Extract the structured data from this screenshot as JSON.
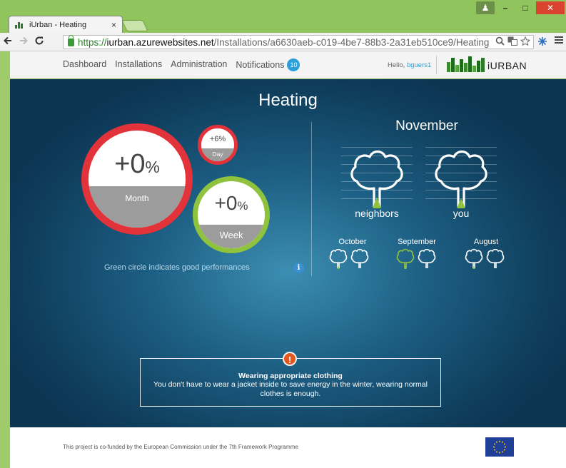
{
  "browser": {
    "tab_title": "iUrban - Heating",
    "tab_close": "×",
    "url_scheme": "https://",
    "url_host": "iurban.azurewebsites.net",
    "url_path": "/Installations/a6630aeb-c019-4be7-88b3-2a31eb510ce9/Heating",
    "back_icon": "back-arrow-icon",
    "forward_icon": "forward-arrow-icon",
    "reload_icon": "reload-icon",
    "window_user_glyph": "♟",
    "minimize_glyph": "–",
    "maximize_glyph": "□",
    "close_glyph": "✕"
  },
  "header": {
    "nav": {
      "dashboard": "Dashboard",
      "installations": "Installations",
      "administration": "Administration",
      "notifications": "Notifications",
      "notification_count": "10"
    },
    "hello_prefix": "Hello, ",
    "username": "bguers1",
    "logo_text": "iURBAN"
  },
  "main": {
    "title": "Heating",
    "circles": {
      "month": {
        "value": "+0",
        "unit": "%",
        "label": "Month",
        "status": "bad"
      },
      "day": {
        "value": "+6%",
        "label": "Day",
        "status": "bad"
      },
      "week": {
        "value": "+0",
        "unit": "%",
        "label": "Week",
        "status": "good"
      }
    },
    "legend_text": "Green circle indicates good performances",
    "info_glyph": "i",
    "comparison": {
      "month_title": "November",
      "neighbors_label": "neighbors",
      "you_label": "you",
      "history": [
        {
          "month": "October"
        },
        {
          "month": "September"
        },
        {
          "month": "August"
        }
      ]
    },
    "tip": {
      "badge": "!",
      "title": "Wearing appropriate clothing",
      "body": "You don't have to wear a jacket inside to save energy in the winter, wearing normal clothes is enough."
    }
  },
  "footer": {
    "text": "This project is co-funded by the European Commission under the 7th Framework Programme"
  },
  "colors": {
    "bad": "#e2323a",
    "good": "#8fc23d",
    "accent": "#2a9fd8",
    "tip_badge": "#e4571f"
  }
}
